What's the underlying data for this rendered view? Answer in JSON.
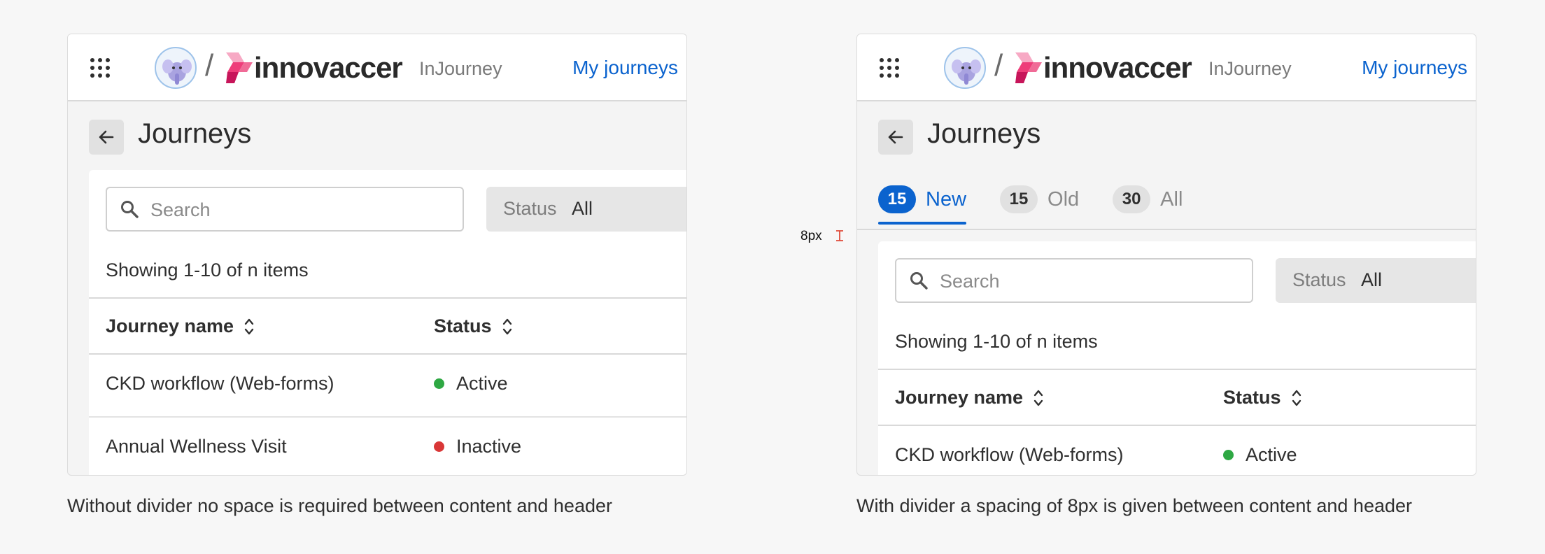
{
  "nav": {
    "org_logo": "innovaccer",
    "product": "InJourney",
    "link": "My journeys"
  },
  "page": {
    "title": "Journeys"
  },
  "tabs": [
    {
      "count": "15",
      "label": "New",
      "active": true
    },
    {
      "count": "15",
      "label": "Old",
      "active": false
    },
    {
      "count": "30",
      "label": "All",
      "active": false
    }
  ],
  "filters": {
    "search_placeholder": "Search",
    "status_label": "Status",
    "status_value": "All"
  },
  "table": {
    "summary": "Showing 1-10 of n items",
    "columns": [
      "Journey name",
      "Status"
    ],
    "rows": [
      {
        "name": "CKD workflow (Web-forms)",
        "status": "Active",
        "status_color": "#2ea843"
      },
      {
        "name": "Annual Wellness Visit",
        "status": "Inactive",
        "status_color": "#d93737"
      }
    ]
  },
  "annotation": {
    "spacing_label": "8px"
  },
  "captions": {
    "left": "Without divider no space is required between content and header",
    "right": "With divider a spacing of 8px is given between content and header"
  },
  "colors": {
    "accent": "#0b63ce",
    "active": "#2ea843",
    "inactive": "#d93737",
    "marker": "#e04b3a"
  }
}
